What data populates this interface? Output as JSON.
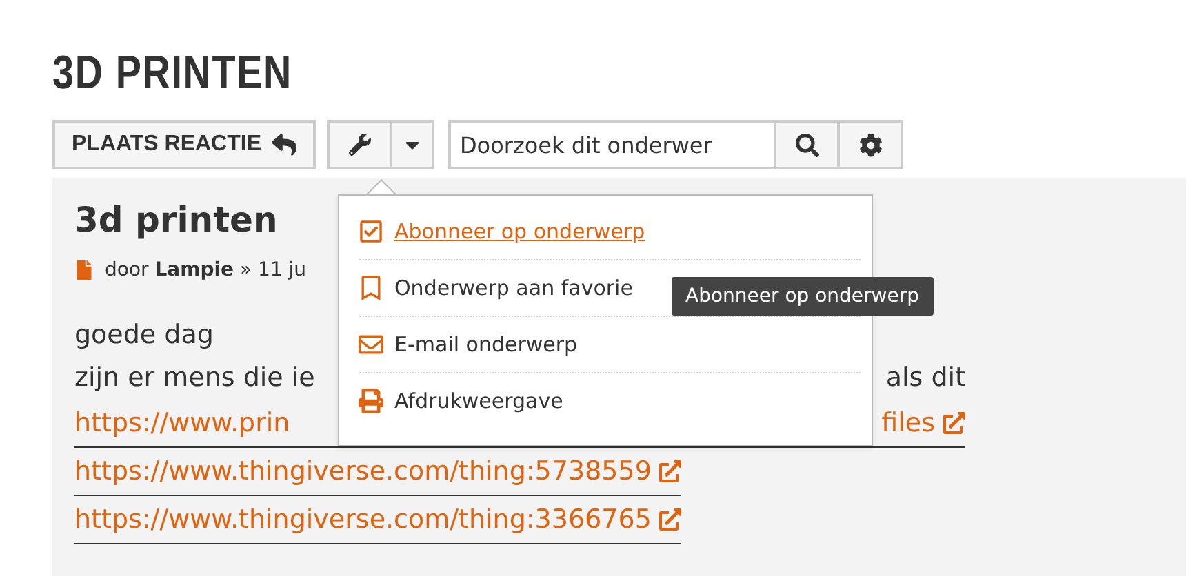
{
  "page_title": "3D PRINTEN",
  "toolbar": {
    "reply_button": "PLAATS REACTIE",
    "search": {
      "placeholder": "Doorzoek dit onderwer"
    }
  },
  "tools_menu": {
    "open": true,
    "items": [
      {
        "kind": "subscribe",
        "label": "Abonneer op onderwerp",
        "hovered": true
      },
      {
        "kind": "bookmark",
        "label": "Onderwerp aan favorie",
        "hovered": false
      },
      {
        "kind": "email",
        "label": "E-mail onderwerp",
        "hovered": false
      },
      {
        "kind": "print",
        "label": "Afdrukweergave",
        "hovered": false
      }
    ]
  },
  "tooltip": "Abonneer op onderwerp",
  "post": {
    "title": "3d printen",
    "byline": "door **Lampie** » 11 ju",
    "lines": [
      {
        "kind": "text",
        "left": "goede dag"
      },
      {
        "kind": "text",
        "left": "zijn er mens die ie",
        "right": "als dit"
      },
      {
        "kind": "link",
        "left": "https://www.prin",
        "right": "files"
      },
      {
        "kind": "link",
        "left": "https://www.thingiverse.com/thing:5738559"
      },
      {
        "kind": "link",
        "left": "https://www.thingiverse.com/thing:3366765"
      }
    ]
  }
}
